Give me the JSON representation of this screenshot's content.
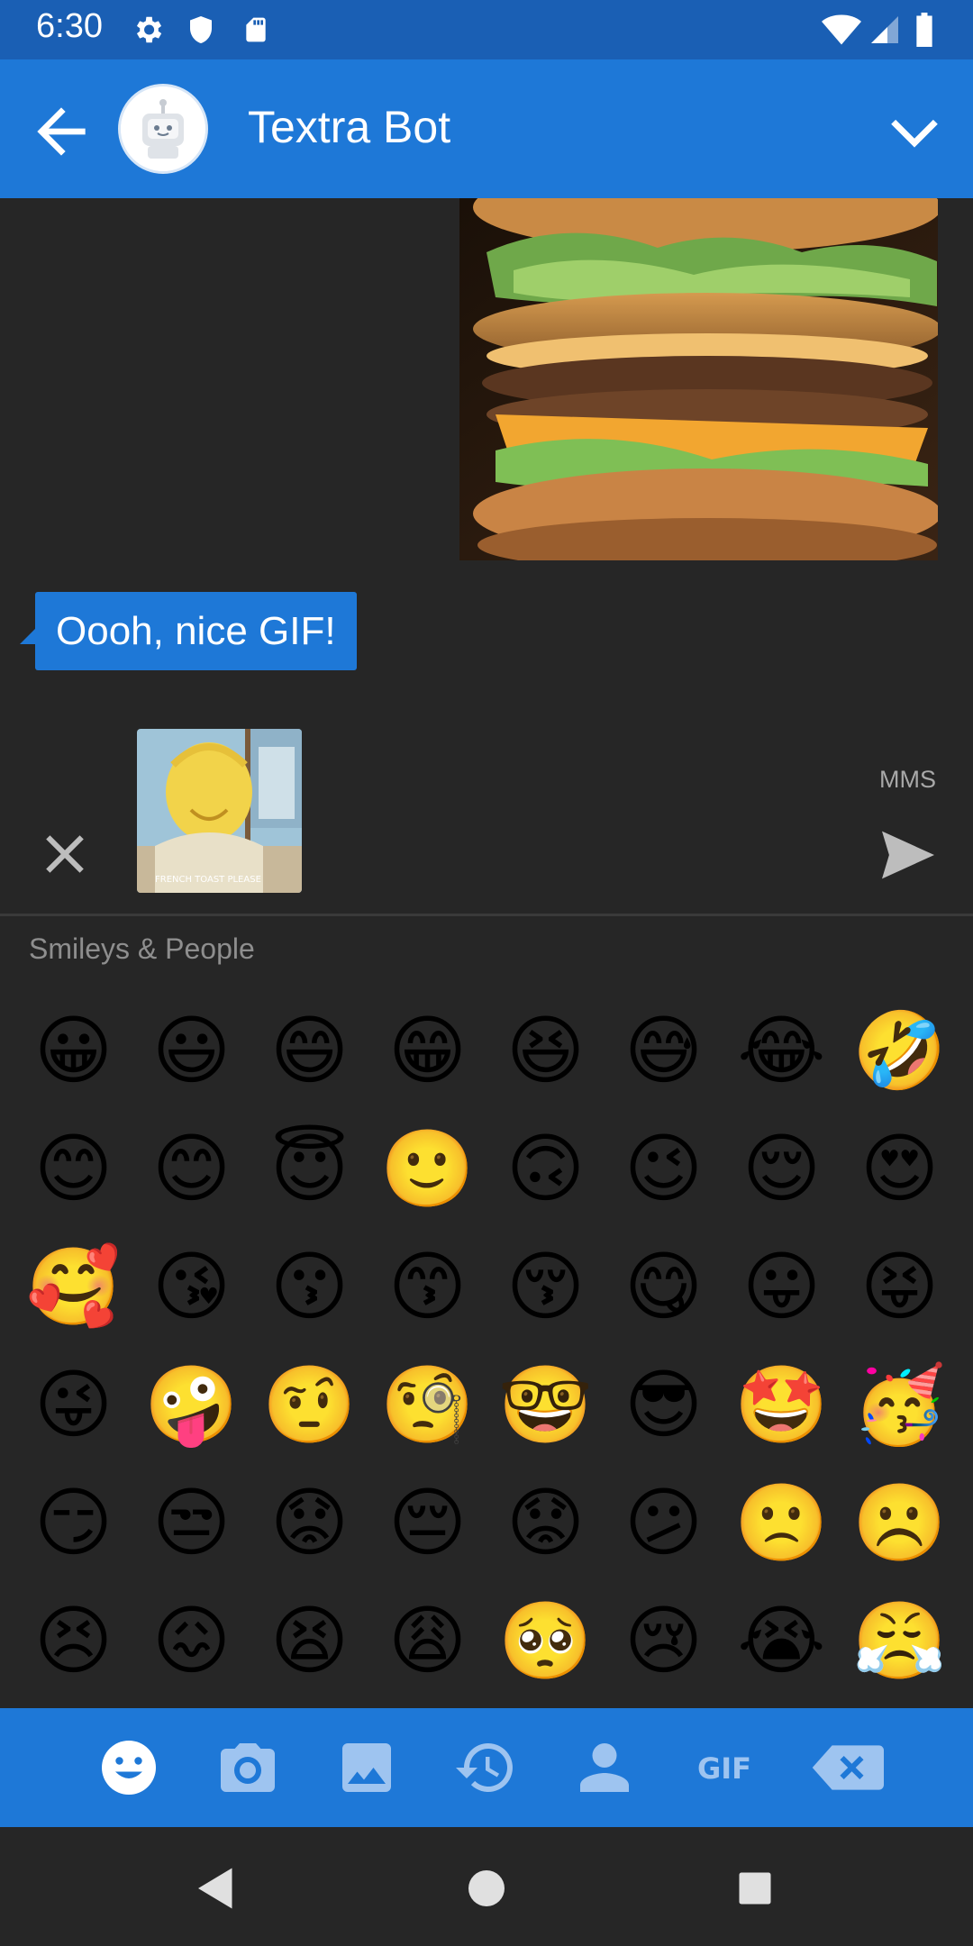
{
  "status_bar": {
    "time": "6:30",
    "icons": [
      "gear-icon",
      "shield-icon",
      "sd-card-icon",
      "wifi-icon",
      "signal-icon",
      "battery-icon"
    ]
  },
  "app_bar": {
    "title": "Textra Bot",
    "back_icon": "arrow-left-icon",
    "expand_icon": "chevron-down-icon"
  },
  "messages": [
    {
      "type": "gif",
      "direction": "outgoing",
      "description_icon": "burger-gif"
    },
    {
      "type": "text",
      "direction": "incoming",
      "text": "Oooh, nice GIF!"
    }
  ],
  "compose": {
    "attachment_caption": "FRENCH TOAST PLEASE",
    "mms_label": "MMS",
    "close_icon": "close-icon",
    "send_icon": "send-icon"
  },
  "emoji_panel": {
    "category": "Smileys & People",
    "emojis": [
      "😀",
      "😃",
      "😄",
      "😁",
      "😆",
      "😅",
      "😂",
      "🤣",
      "😊",
      "😊",
      "😇",
      "🙂",
      "🙃",
      "😉",
      "😌",
      "😍",
      "🥰",
      "😘",
      "😗",
      "😙",
      "😚",
      "😋",
      "😛",
      "😝",
      "😜",
      "🤪",
      "🤨",
      "🧐",
      "🤓",
      "😎",
      "🤩",
      "🥳",
      "😏",
      "😒",
      "😟",
      "😔",
      "😟",
      "😕",
      "🙁",
      "☹️",
      "😣",
      "😖",
      "😫",
      "😩",
      "🥺",
      "😢",
      "😭",
      "😤"
    ]
  },
  "toolbar": {
    "items": [
      "emoji-icon",
      "camera-icon",
      "image-icon",
      "history-icon",
      "person-icon",
      "gif-icon",
      "backspace-icon"
    ],
    "gif_label": "GIF"
  },
  "nav_bar": {
    "items": [
      "back-triangle-icon",
      "home-circle-icon",
      "recents-square-icon"
    ]
  },
  "colors": {
    "status_bar": "#1a5fb4",
    "app_bar": "#1e78d7",
    "background": "#262626",
    "bubble": "#1e78d7",
    "toolbar_icon": "#9ec4f0"
  }
}
